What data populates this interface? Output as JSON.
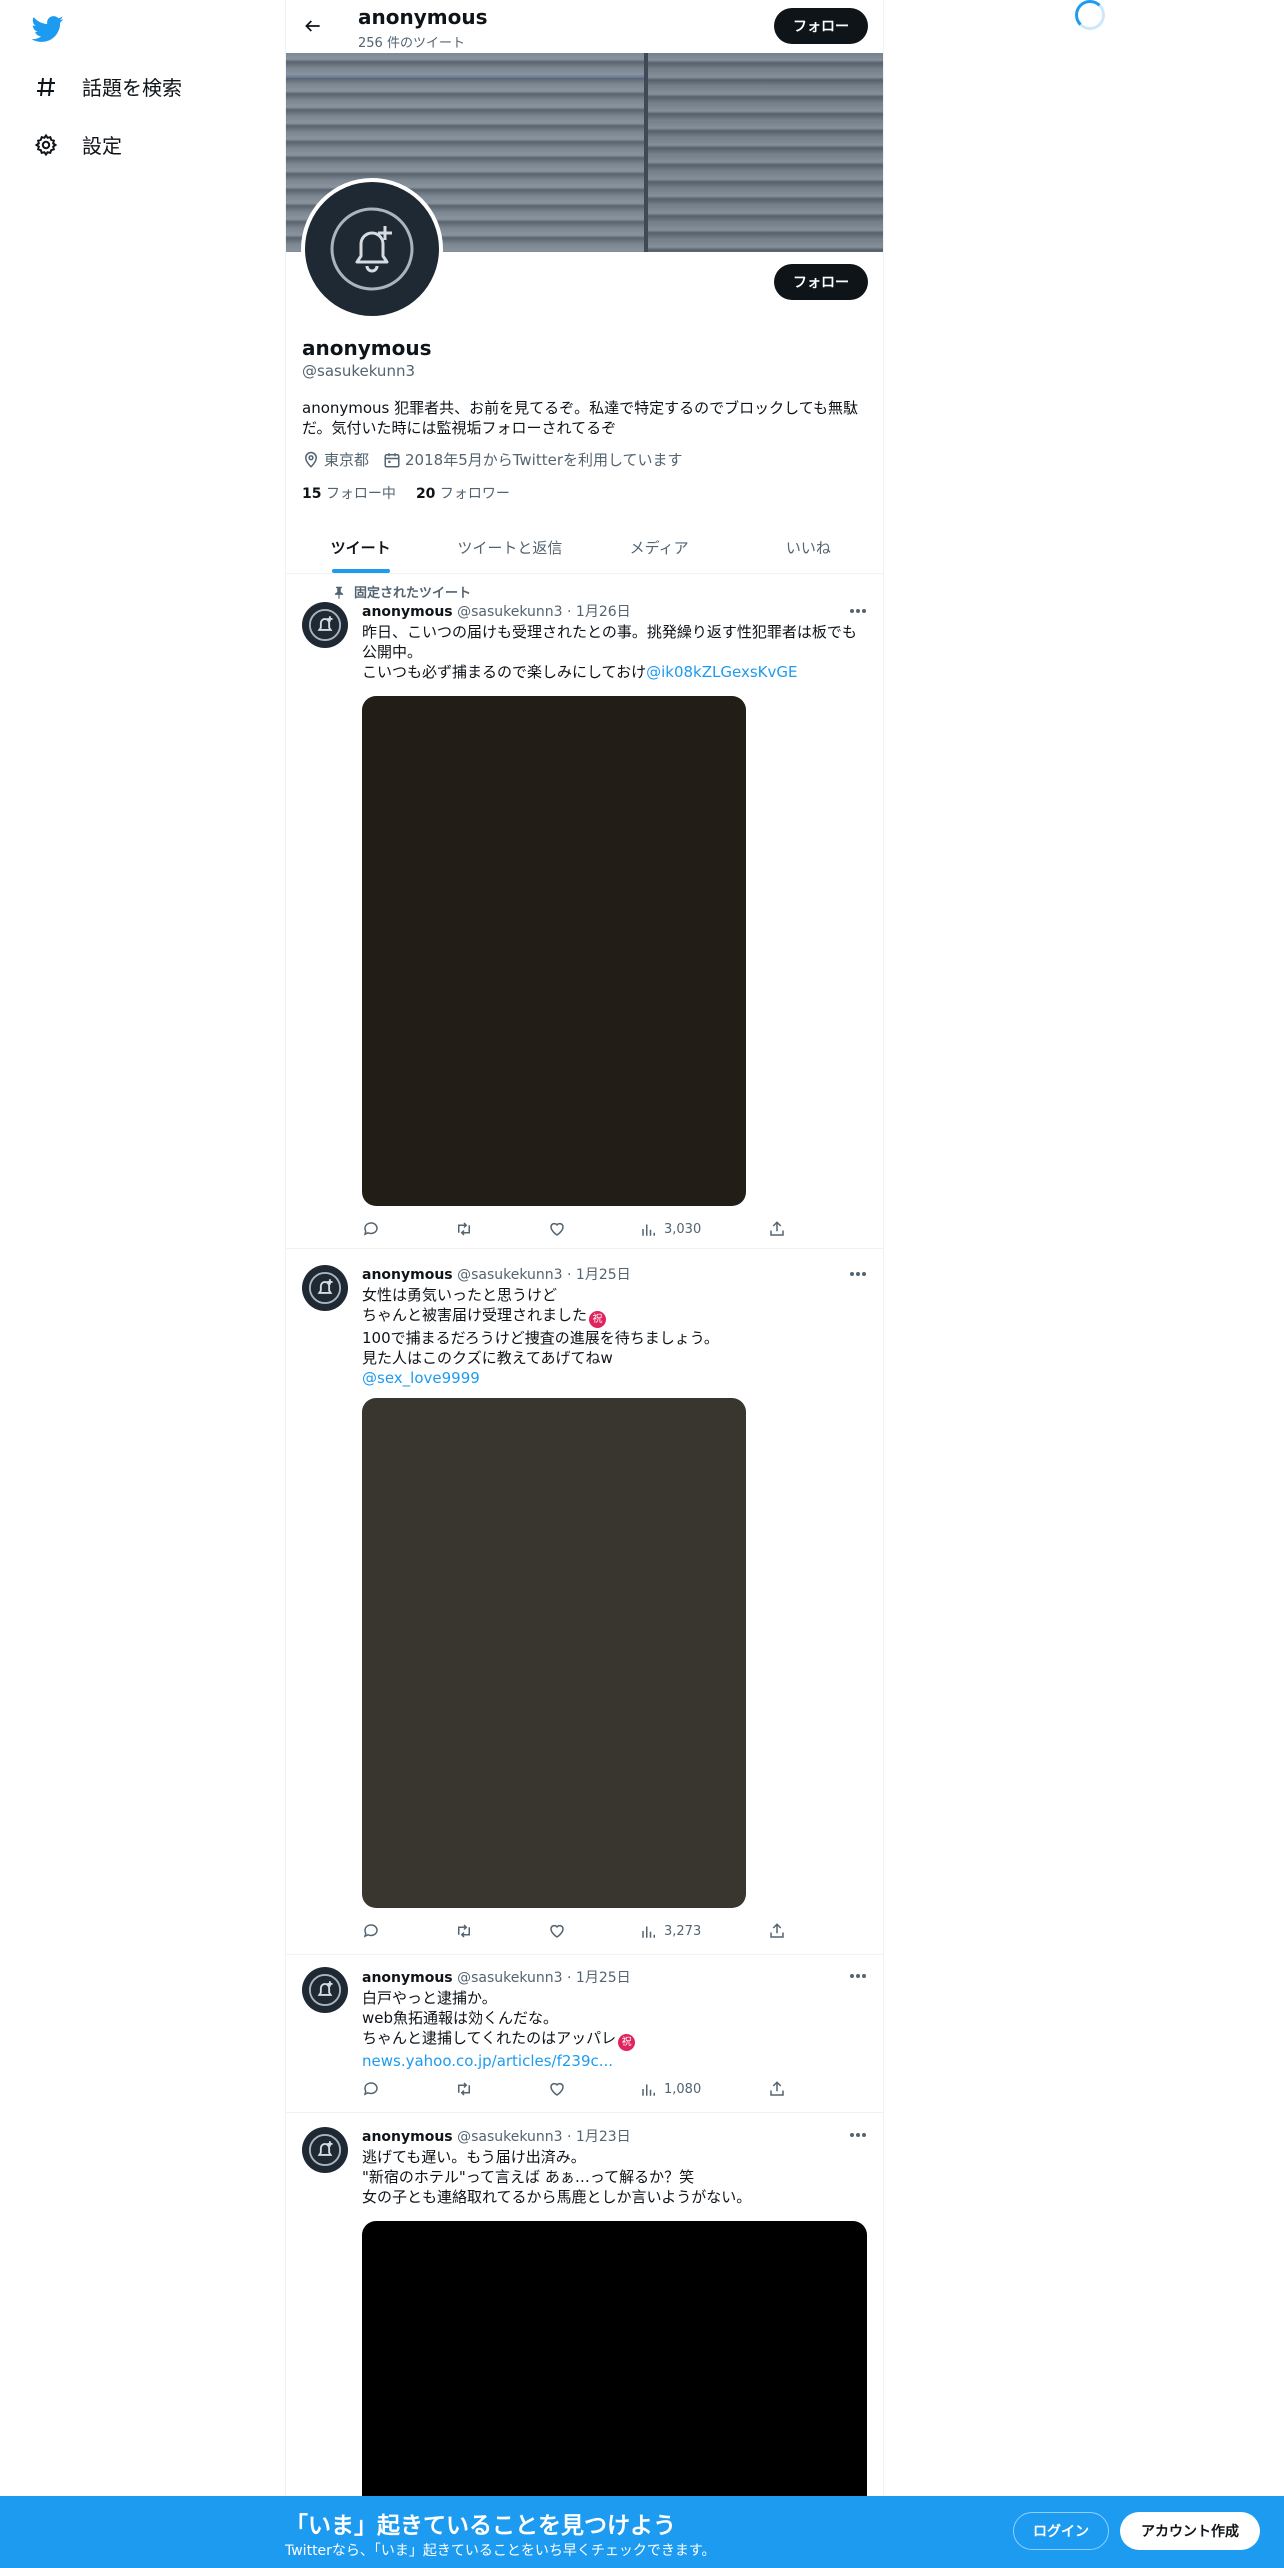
{
  "sidebar": {
    "logo": "twitter-bird-icon",
    "items": [
      {
        "icon": "hashtag-icon",
        "label": "話題を検索"
      },
      {
        "icon": "gear-icon",
        "label": "設定"
      }
    ]
  },
  "header": {
    "title": "anonymous",
    "tweet_count": "256 件のツイート",
    "follow_label": "フォロー"
  },
  "profile": {
    "name": "anonymous",
    "handle": "@sasukekunn3",
    "follow_label": "フォロー",
    "bio_line1": "anonymous 犯罪者共、お前を見てるぞ。私達で特定するのでブロックしても無駄",
    "bio_line2": "だ。気付いた時には監視垢フォローされてるぞ",
    "location": "東京都",
    "joined": "2018年5月からTwitterを利用しています",
    "following_count": "15",
    "following_label": "フォロー中",
    "followers_count": "20",
    "followers_label": "フォロワー"
  },
  "tabs": [
    {
      "label": "ツイート",
      "active": true
    },
    {
      "label": "ツイートと返信",
      "active": false
    },
    {
      "label": "メディア",
      "active": false
    },
    {
      "label": "いいね",
      "active": false
    }
  ],
  "tweets": [
    {
      "pinned_label": "固定されたツイート",
      "name": "anonymous",
      "handle": "@sasukekunn3",
      "date": "· 1月26日",
      "lines": [
        "昨日、こいつの届けも受理されたとの事。挑発繰り返す性犯罪者は板でも",
        "公開中。",
        "こいつも必ず捕まるので楽しみにしておけ"
      ],
      "link": "@ik08kZLGexsKvGE",
      "media_color": "#221d17",
      "views": "3,030"
    },
    {
      "name": "anonymous",
      "handle": "@sasukekunn3",
      "date": "· 1月25日",
      "lines": [
        "女性は勇気いったと思うけど",
        "ちゃんと被害届け受理されました",
        "100で捕まるだろうけど捜査の進展を待ちましょう。",
        "見た人はこのクズに教えてあげてねw"
      ],
      "emoji": "祝",
      "link": "@sex_love9999",
      "media_color": "#38362e",
      "views": "3,273"
    },
    {
      "name": "anonymous",
      "handle": "@sasukekunn3",
      "date": "· 1月25日",
      "lines": [
        "白戸やっと逮捕か。",
        "web魚拓通報は効くんだな。",
        "ちゃんと逮捕してくれたのはアッパレ"
      ],
      "emoji": "祝",
      "link": "news.yahoo.co.jp/articles/f239c...",
      "views": "1,080"
    },
    {
      "name": "anonymous",
      "handle": "@sasukekunn3",
      "date": "· 1月23日",
      "lines": [
        "逃げても遅い。もう届け出済み。",
        "\"新宿のホテル\"って言えば あぁ…って解るか？笑",
        "女の子とも連絡取れてるから馬鹿としか言いようがない。"
      ],
      "media_color": "#000000"
    }
  ],
  "bottom_bar": {
    "title": "「いま」起きていることを見つけよう",
    "subtitle": "Twitterなら、「いま」起きていることをいち早くチェックできます。",
    "login_label": "ログイン",
    "signup_label": "アカウント作成"
  },
  "colors": {
    "accent": "#1d9bf0",
    "text": "#0f1419",
    "secondary": "#536471"
  }
}
